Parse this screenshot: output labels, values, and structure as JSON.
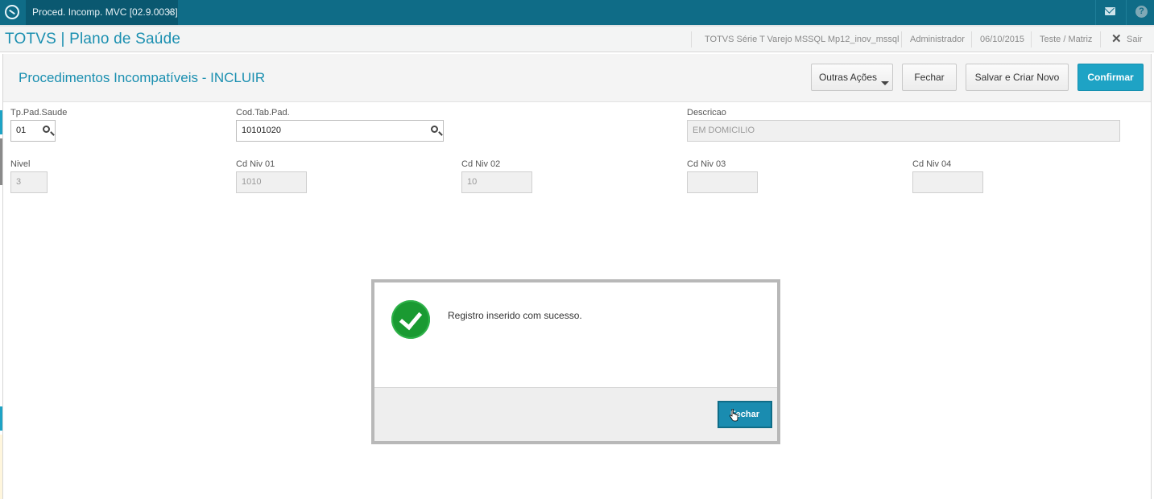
{
  "topbar": {
    "tab_label": "Proced. Incomp. MVC [02.9.0033]",
    "tab_close": "×",
    "help_label": "?"
  },
  "header": {
    "brand": "TOTVS | Plano de Saúde",
    "environment": "TOTVS Série T Varejo MSSQL Mp12_inov_mssql",
    "user": "Administrador",
    "date": "06/10/2015",
    "branch": "Teste / Matriz",
    "logout_label": "Sair"
  },
  "page": {
    "title": "Procedimentos Incompatíveis - INCLUIR",
    "buttons": {
      "other_actions": "Outras Ações",
      "close": "Fechar",
      "save_new": "Salvar e Criar Novo",
      "confirm": "Confirmar"
    }
  },
  "form": {
    "tp_pad_saude": {
      "label": "Tp.Pad.Saude",
      "value": "01"
    },
    "cod_tab_pad": {
      "label": "Cod.Tab.Pad.",
      "value": "10101020"
    },
    "descricao": {
      "label": "Descricao",
      "value": "EM DOMICILIO"
    },
    "nivel": {
      "label": "Nivel",
      "value": "3"
    },
    "cd_niv_01": {
      "label": "Cd Niv 01",
      "value": "1010"
    },
    "cd_niv_02": {
      "label": "Cd Niv 02",
      "value": "10"
    },
    "cd_niv_03": {
      "label": "Cd Niv 03",
      "value": ""
    },
    "cd_niv_04": {
      "label": "Cd Niv 04",
      "value": ""
    }
  },
  "dialog": {
    "message": "Registro inserido com sucesso.",
    "close_label": "Fechar"
  },
  "colors": {
    "topbar": "#0f6c87",
    "accent": "#1a8fb0",
    "primary_button": "#1ea3c5",
    "success": "#1a9a32"
  }
}
